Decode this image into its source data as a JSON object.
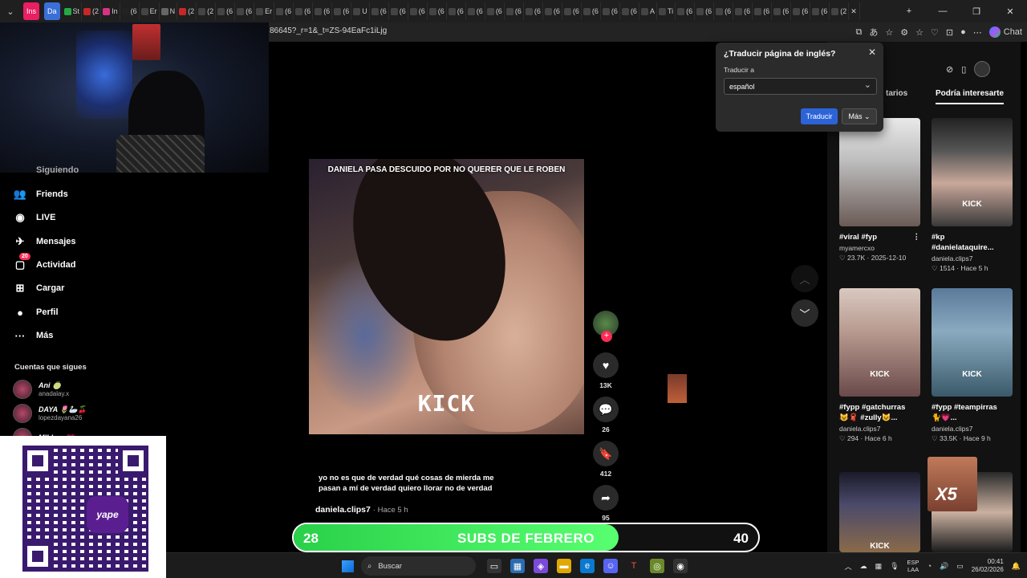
{
  "browser": {
    "tabs": [
      {
        "label": "Ins",
        "color": "#e91e63",
        "pill": true
      },
      {
        "label": "Da",
        "color": "#3b6fd8",
        "pill": true
      },
      {
        "label": "St",
        "color": "#22aa44"
      },
      {
        "label": "(2",
        "color": "#c62828"
      },
      {
        "label": "In",
        "color": "#d63384"
      },
      {
        "label": "(6",
        "color": "#222"
      },
      {
        "label": "Er",
        "color": "#444"
      },
      {
        "label": "N",
        "color": "#666"
      },
      {
        "label": "(2",
        "color": "#c62828"
      },
      {
        "label": "(2",
        "color": "#444"
      },
      {
        "label": "(6",
        "color": "#444"
      },
      {
        "label": "(6",
        "color": "#444"
      },
      {
        "label": "Er",
        "color": "#444"
      },
      {
        "label": "(6",
        "color": "#444"
      },
      {
        "label": "(6",
        "color": "#444"
      },
      {
        "label": "(6",
        "color": "#444"
      },
      {
        "label": "(6",
        "color": "#444"
      },
      {
        "label": "U",
        "color": "#444"
      },
      {
        "label": "(6",
        "color": "#444"
      },
      {
        "label": "(6",
        "color": "#444"
      },
      {
        "label": "(6",
        "color": "#444"
      },
      {
        "label": "(6",
        "color": "#444"
      },
      {
        "label": "(6",
        "color": "#444"
      },
      {
        "label": "(6",
        "color": "#444"
      },
      {
        "label": "(6",
        "color": "#444"
      },
      {
        "label": "(6",
        "color": "#444"
      },
      {
        "label": "(6",
        "color": "#444"
      },
      {
        "label": "(6",
        "color": "#444"
      },
      {
        "label": "(6",
        "color": "#444"
      },
      {
        "label": "(6",
        "color": "#444"
      },
      {
        "label": "(6",
        "color": "#444"
      },
      {
        "label": "(6",
        "color": "#444"
      },
      {
        "label": "A",
        "color": "#444"
      },
      {
        "label": "Ti",
        "color": "#444"
      },
      {
        "label": "(6",
        "color": "#444"
      },
      {
        "label": "(6",
        "color": "#444"
      },
      {
        "label": "(6",
        "color": "#444"
      },
      {
        "label": "(6",
        "color": "#444"
      },
      {
        "label": "(6",
        "color": "#444"
      },
      {
        "label": "(6",
        "color": "#444"
      },
      {
        "label": "(6",
        "color": "#444"
      },
      {
        "label": "(6",
        "color": "#444"
      },
      {
        "label": "(2",
        "color": "#444"
      }
    ],
    "new_tab": "+",
    "url": "86645?_r=1&_t=ZS-94EaFc1iLjg",
    "chat_label": "Chat"
  },
  "translate_popup": {
    "title": "¿Traducir página de inglés?",
    "translate_to_label": "Traducir a",
    "selected_language": "español",
    "translate_button": "Traducir",
    "more_button": "Más"
  },
  "sidebar": {
    "partial_item": "Siguiendo",
    "items": [
      {
        "label": "Friends",
        "icon": "friends-icon",
        "glyph": "👥"
      },
      {
        "label": "LIVE",
        "icon": "live-icon",
        "glyph": "◉"
      },
      {
        "label": "Mensajes",
        "icon": "messages-icon",
        "glyph": "✈"
      },
      {
        "label": "Actividad",
        "icon": "activity-icon",
        "glyph": "▢",
        "badge": "20"
      },
      {
        "label": "Cargar",
        "icon": "upload-icon",
        "glyph": "⊞"
      },
      {
        "label": "Perfil",
        "icon": "profile-icon",
        "glyph": "●"
      },
      {
        "label": "Más",
        "icon": "more-icon",
        "glyph": "···"
      }
    ],
    "following_title": "Cuentas que sigues",
    "following": [
      {
        "name": "Ani 🍈",
        "handle": "anadalay.x"
      },
      {
        "name": "DAYA 🌷🦢🍒",
        "handle": "lopezdayana26"
      },
      {
        "name": "MILIxxx💗",
        "handle": ""
      }
    ]
  },
  "video": {
    "caption": "DANIELA PASA DESCUIDO POR NO QUERER QUE LE ROBEN",
    "watermark": "KICK",
    "description": "yo no es que de verdad qué cosas de mierda me pasan a mí de verdad quiero llorar no de verdad",
    "author": "daniela.clips7",
    "time": "· Hace 5 h",
    "likes": "13K",
    "comments": "26",
    "saves": "412",
    "shares": "95"
  },
  "right_panel": {
    "tabs": [
      "tarios",
      "Podría interesarte"
    ],
    "cards": [
      {
        "title": "#viral #fyp",
        "author": "myamercxo",
        "meta": "♡ 23.7K · 2025-12-10",
        "kick": ""
      },
      {
        "title": "#kp #danielataquire...",
        "author": "daniela.clips7",
        "meta": "♡ 1514 · Hace 5 h",
        "kick": "KICK"
      },
      {
        "title": "#fypp #gatchurras 😺🧣 #zully😺...",
        "author": "daniela.clips7",
        "meta": "♡ 294 · Hace 6 h",
        "kick": "KICK"
      },
      {
        "title": "#fypp #teampirras 🐈💗...",
        "author": "daniela.clips7",
        "meta": "♡ 33.5K · Hace 9 h",
        "kick": "KICK"
      },
      {
        "title": "",
        "author": "",
        "meta": "",
        "kick": "KICK"
      },
      {
        "title": "",
        "author": "",
        "meta": "",
        "kick": ""
      }
    ],
    "x5_overlay": "X5"
  },
  "subs_bar": {
    "current": "28",
    "goal": "40",
    "label": "SUBS DE FEBRERO",
    "progress": 0.7,
    "color": "#3be05a"
  },
  "qr": {
    "brand": "yape"
  },
  "taskbar": {
    "search_placeholder": "Buscar",
    "language": "ESP",
    "region": "LAA",
    "time": "00:41",
    "date": "26/02/2026"
  }
}
